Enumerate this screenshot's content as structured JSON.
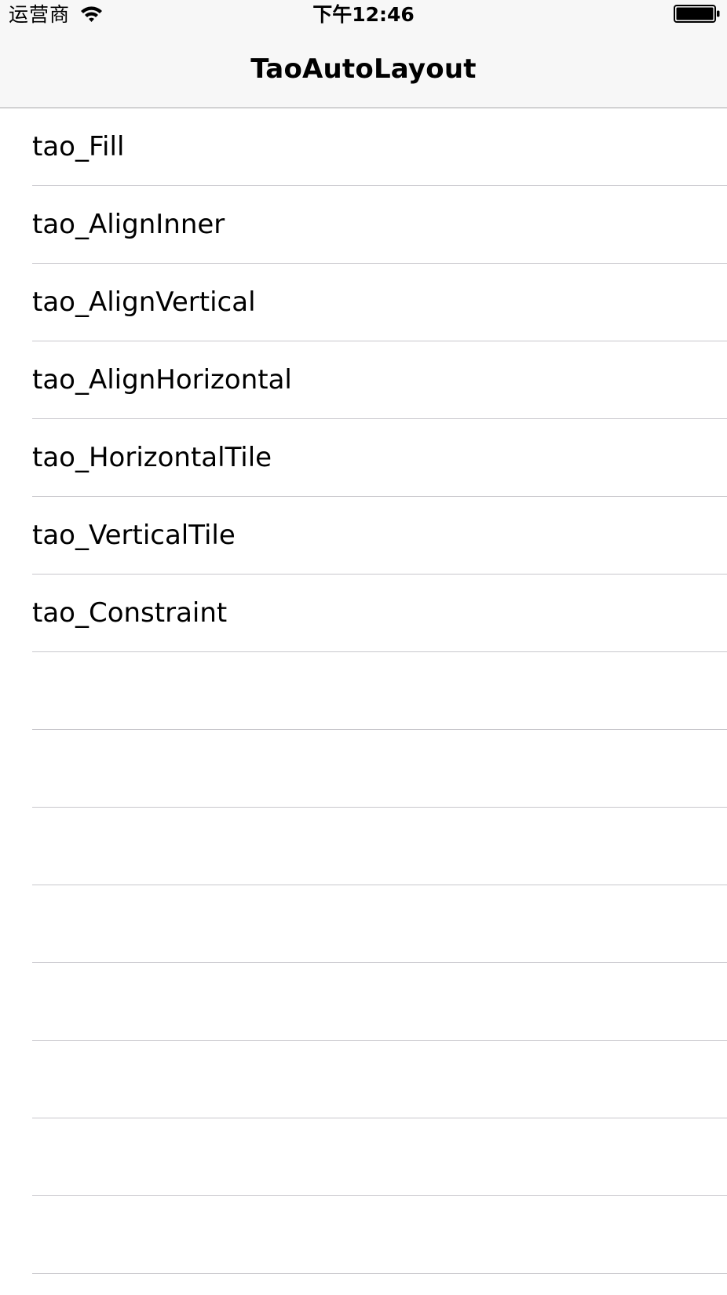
{
  "status_bar": {
    "carrier": "运营商",
    "time": "下午12:46",
    "wifi_icon": "wifi-icon",
    "battery_icon": "battery-icon"
  },
  "nav": {
    "title": "TaoAutoLayout"
  },
  "table": {
    "rows": [
      {
        "label": "tao_Fill"
      },
      {
        "label": "tao_AlignInner"
      },
      {
        "label": "tao_AlignVertical"
      },
      {
        "label": "tao_AlignHorizontal"
      },
      {
        "label": "tao_HorizontalTile"
      },
      {
        "label": "tao_VerticalTile"
      },
      {
        "label": "tao_Constraint"
      },
      {
        "label": ""
      },
      {
        "label": ""
      },
      {
        "label": ""
      },
      {
        "label": ""
      },
      {
        "label": ""
      },
      {
        "label": ""
      },
      {
        "label": ""
      },
      {
        "label": ""
      },
      {
        "label": ""
      }
    ]
  },
  "colors": {
    "chrome_background": "#f7f7f7",
    "separator": "#c8c7cc",
    "text": "#000000"
  }
}
